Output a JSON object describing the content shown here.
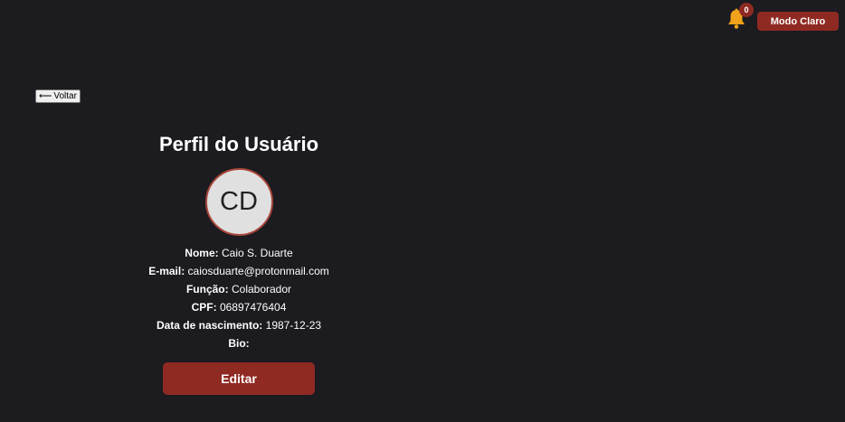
{
  "header": {
    "notification_count": "0",
    "bell_icon": "bell-icon",
    "theme_toggle_label": "Modo Claro"
  },
  "nav": {
    "back_label": "Voltar",
    "back_icon": "arrow-left-icon"
  },
  "profile": {
    "title": "Perfil do Usuário",
    "avatar_initials": "CD",
    "fields": {
      "name_label": "Nome:",
      "name_value": "Caio S. Duarte",
      "email_label": "E-mail:",
      "email_value": "caiosduarte@protonmail.com",
      "role_label": "Função:",
      "role_value": "Colaborador",
      "cpf_label": "CPF:",
      "cpf_value": "06897476404",
      "birth_label": "Data de nascimento:",
      "birth_value": "1987-12-23",
      "bio_label": "Bio:",
      "bio_value": ""
    },
    "edit_label": "Editar"
  },
  "colors": {
    "background": "#1b1b20",
    "accent": "#8f2a22",
    "bell": "#f0a31a",
    "avatar_bg": "#e0e0e0",
    "avatar_border": "#a8463b"
  }
}
